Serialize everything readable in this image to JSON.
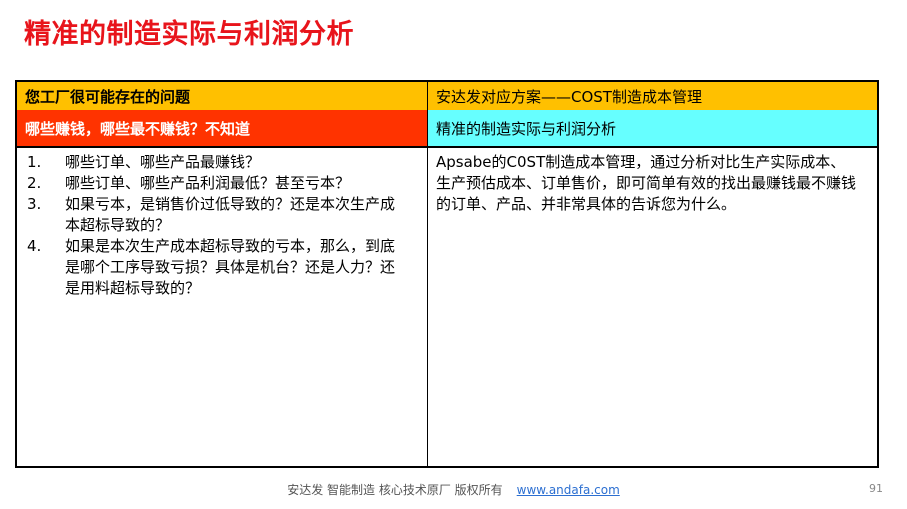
{
  "title": "精准的制造实际与利润分析",
  "table": {
    "header_left": "您工厂很可能存在的问题",
    "header_right": "安达发对应方案——COST制造成本管理",
    "sub_left": "哪些赚钱，哪些最不赚钱？不知道",
    "sub_right": "精准的制造实际与利润分析",
    "problems": [
      {
        "num": "1.",
        "text": "哪些订单、哪些产品最赚钱？"
      },
      {
        "num": "2.",
        "text": "哪些订单、哪些产品利润最低？甚至亏本？"
      },
      {
        "num": "3.",
        "text": "如果亏本，是销售价过低导致的？还是本次生产成本超标导致的？"
      },
      {
        "num": "4.",
        "text": "如果是本次生产成本超标导致的亏本，那么，到底是哪个工序导致亏损？具体是机台？还是人力？还是用料超标导致的？"
      }
    ],
    "solution": "Apsabe的C0ST制造成本管理，通过分析对比生产实际成本、生产预估成本、订单售价，即可简单有效的找出最赚钱最不赚钱的订单、产品、并非常具体的告诉您为什么。"
  },
  "footer": {
    "text": "安达发   智能制造 核心技术原厂   版权所有",
    "link": "www.andafa.com",
    "page": "91"
  }
}
